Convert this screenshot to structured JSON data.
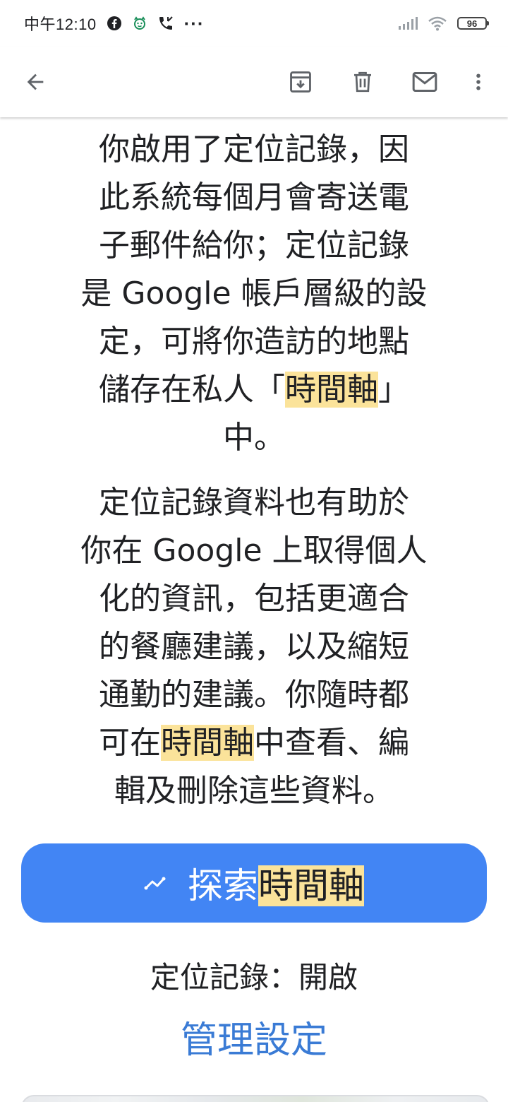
{
  "status_bar": {
    "time": "中午12:10",
    "more": "···",
    "battery": "96"
  },
  "icons": {
    "facebook": "facebook-icon",
    "cat": "cat-icon",
    "call": "phone-call-icon",
    "signal": "signal-icon",
    "wifi": "wifi-icon",
    "back": "arrow-back-icon",
    "archive": "archive-icon",
    "delete": "trash-icon",
    "mail": "mail-icon",
    "more": "more-vert-icon",
    "timeline": "timeline-icon"
  },
  "email": {
    "paragraph1": [
      {
        "text": "你啟用了定位記錄，因"
      },
      {
        "text": "此系統每個月會寄送電"
      },
      {
        "text": "子郵件給你；定位記錄"
      },
      {
        "text": "是 Google 帳戶層級的設"
      },
      {
        "text": "定，可將你造訪的地點"
      },
      {
        "before": "儲存在私人「",
        "highlight": "時間軸",
        "after": "」"
      },
      {
        "text": "中。"
      }
    ],
    "paragraph2": [
      {
        "text": "定位記錄資料也有助於"
      },
      {
        "text": "你在 Google 上取得個人"
      },
      {
        "text": "化的資訊，包括更適合"
      },
      {
        "text": "的餐廳建議，以及縮短"
      },
      {
        "text": "通勤的建議。你隨時都"
      },
      {
        "before": "可在",
        "highlight": "時間軸",
        "after": "中查看、編"
      },
      {
        "text": "輯及刪除這些資料。"
      }
    ],
    "cta": {
      "prefix": "探索",
      "highlight": "時間軸"
    },
    "location_status": "定位記錄：開啟",
    "manage_link": "管理設定"
  },
  "colors": {
    "cta_background": "#4285f4",
    "highlight": "#fbe39a",
    "link": "#3a7bd5"
  }
}
